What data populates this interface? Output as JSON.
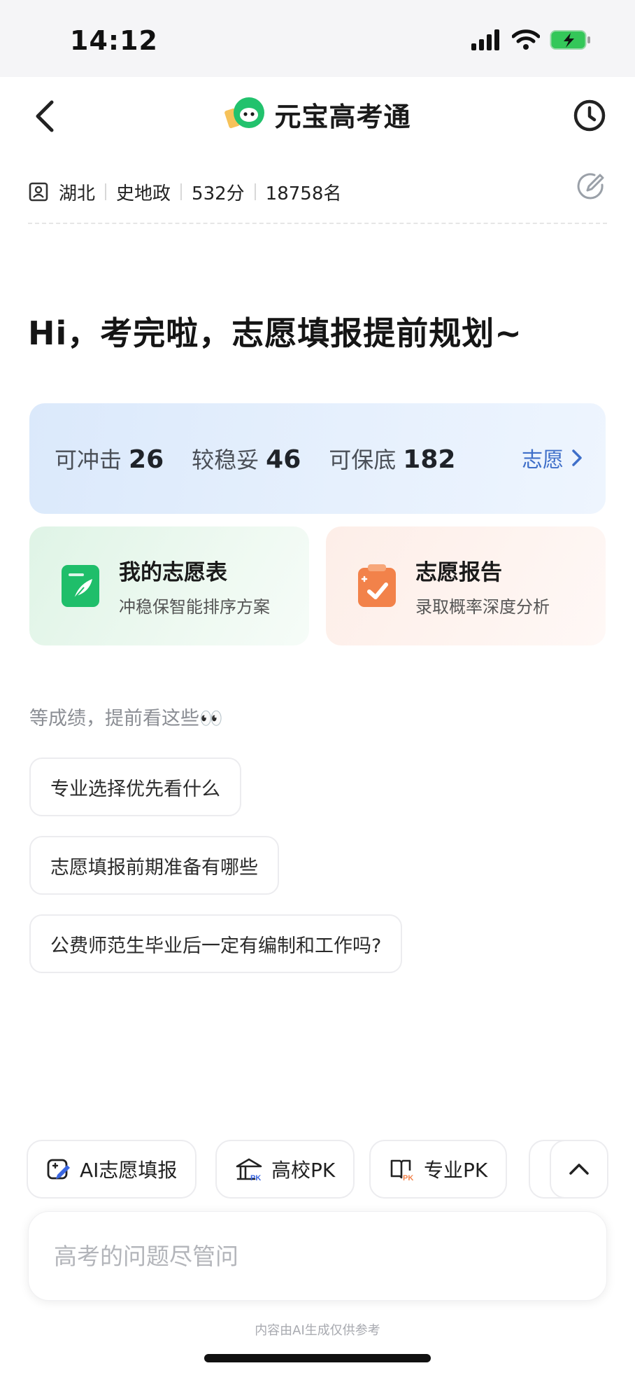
{
  "status": {
    "time": "14:12"
  },
  "nav": {
    "title": "元宝高考通"
  },
  "profile": {
    "province": "湖北",
    "subjects": "史地政",
    "score": "532分",
    "rank": "18758名"
  },
  "greeting": "Hi，考完啦，志愿填报提前规划~",
  "stats": {
    "items": [
      {
        "label": "可冲击",
        "value": "26"
      },
      {
        "label": "较稳妥",
        "value": "46"
      },
      {
        "label": "可保底",
        "value": "182"
      }
    ],
    "link_label": "志愿"
  },
  "cards": [
    {
      "title": "我的志愿表",
      "subtitle": "冲稳保智能排序方案",
      "icon": "form-leaf-icon",
      "accent": "#1fbe6a"
    },
    {
      "title": "志愿报告",
      "subtitle": "录取概率深度分析",
      "icon": "clipboard-check-icon",
      "accent": "#f2824a"
    }
  ],
  "section_title": "等成绩，提前看这些👀",
  "suggestions": [
    "专业选择优先看什么",
    "志愿填报前期准备有哪些",
    "公费师范生毕业后一定有编制和工作吗?"
  ],
  "quick_actions": [
    {
      "label": "AI志愿填报",
      "icon": "ai-edit-icon"
    },
    {
      "label": "高校PK",
      "icon": "school-pk-icon"
    },
    {
      "label": "专业PK",
      "icon": "book-pk-icon"
    }
  ],
  "input": {
    "placeholder": "高考的问题尽管问"
  },
  "disclaimer": "内容由AI生成仅供参考",
  "colors": {
    "brand_green": "#1fbe6a",
    "link_blue": "#3f6fc9",
    "orange": "#f2824a"
  }
}
